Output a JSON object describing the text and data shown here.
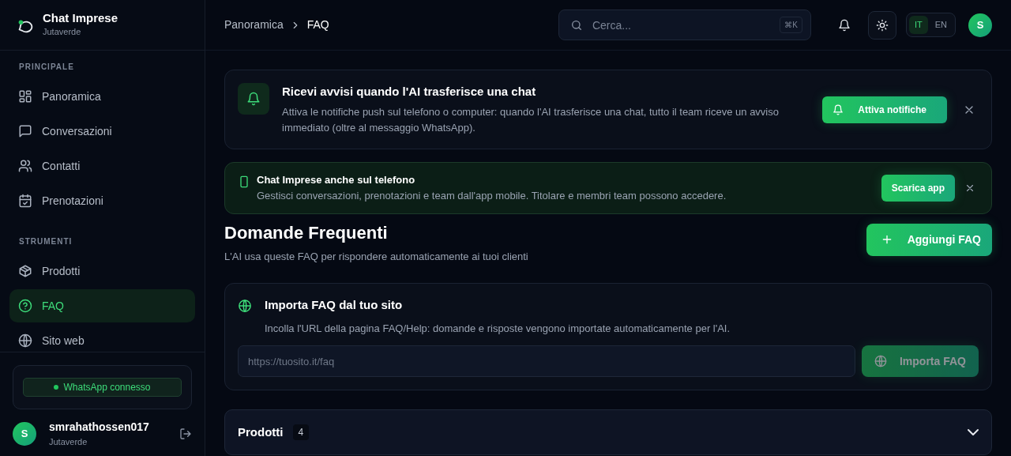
{
  "brand": {
    "title": "Chat Imprese",
    "subtitle": "Jutaverde"
  },
  "sidebar": {
    "sections": [
      {
        "heading": "PRINCIPALE",
        "items": [
          {
            "label": "Panoramica",
            "selected": false
          },
          {
            "label": "Conversazioni",
            "selected": false
          },
          {
            "label": "Contatti",
            "selected": false
          },
          {
            "label": "Prenotazioni",
            "selected": false
          }
        ]
      },
      {
        "heading": "STRUMENTI",
        "items": [
          {
            "label": "Prodotti",
            "selected": false
          },
          {
            "label": "FAQ",
            "selected": true
          },
          {
            "label": "Sito web",
            "selected": false
          }
        ]
      }
    ],
    "whatsapp_status": {
      "label": "WhatsApp connesso",
      "connected": true
    },
    "user": {
      "avatar": "S",
      "name": "smrahathossen017",
      "organization": "Jutaverde"
    }
  },
  "header": {
    "breadcrumb": [
      "Panoramica",
      "FAQ"
    ],
    "search": {
      "placeholder": "Cerca...",
      "shortcut": "⌘K"
    },
    "languages": [
      {
        "label": "IT",
        "selected": true
      },
      {
        "label": "EN",
        "selected": false
      }
    ],
    "avatar": "S"
  },
  "banners": [
    {
      "kind": "notification",
      "title": "Ricevi avvisi quando l'AI trasferisce una chat",
      "text": "Attiva le notifiche push sul telefono o computer: quando l'AI trasferisce una chat, tutto il team riceve un avviso immediato (oltre al messaggio WhatsApp).",
      "button": "Attiva notifiche"
    },
    {
      "kind": "app",
      "title": "Chat Imprese anche sul telefono",
      "text": "Gestisci conversazioni, prenotazioni e team dall'app mobile. Titolare e membri team possono accedere.",
      "button": "Scarica app"
    }
  ],
  "page": {
    "title": "Domande Frequenti",
    "subtitle": "L'AI usa queste FAQ per rispondere automaticamente ai tuoi clienti",
    "add_button": "Aggiungi FAQ"
  },
  "import": {
    "title": "Importa FAQ dal tuo sito",
    "text": "Incolla l'URL della pagina FAQ/Help: domande e risposte vengono importate automaticamente per l'AI.",
    "placeholder": "https://tuosito.it/faq",
    "button": "Importa FAQ",
    "disabled": true
  },
  "categories": [
    {
      "name": "Prodotti",
      "count": "4",
      "expanded": false
    }
  ]
}
